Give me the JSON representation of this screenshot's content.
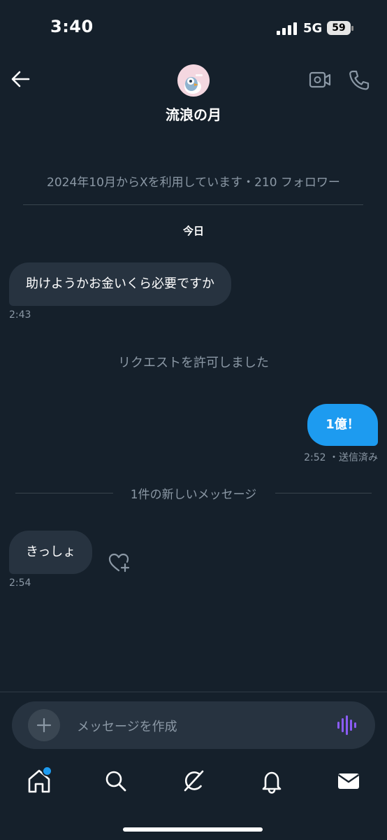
{
  "status_bar": {
    "time": "3:40",
    "network": "5G",
    "battery": "59"
  },
  "header": {
    "title": "流浪の月",
    "avatar": "profile-avatar"
  },
  "info": "2024年10月からXを利用しています・210 フォロワー",
  "day_label": "今日",
  "messages": [
    {
      "direction": "in",
      "text": "助けようかお金いくら必要ですか",
      "time": "2:43"
    },
    {
      "direction": "system",
      "text": "リクエストを許可しました"
    },
    {
      "direction": "out",
      "text": "1億！",
      "time": "2:52",
      "status": "・送信済み"
    },
    {
      "direction": "divider",
      "text": "1件の新しいメッセージ"
    },
    {
      "direction": "in",
      "text": "きっしょ",
      "time": "2:54"
    }
  ],
  "composer": {
    "placeholder": "メッセージを作成"
  },
  "tabs": [
    "home-icon",
    "search-icon",
    "grok-icon",
    "notifications-icon",
    "messages-icon"
  ],
  "colors": {
    "background": "#15202b",
    "accent": "#1d9bf0",
    "bubble_in": "#273340",
    "muted": "#8b98a5",
    "voice": "#8b5cf6"
  }
}
